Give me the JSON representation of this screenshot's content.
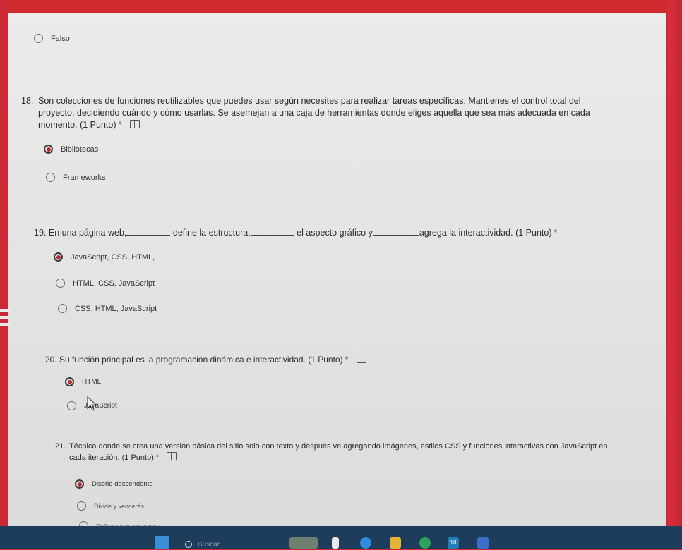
{
  "colors": {
    "accent": "#b72b2e",
    "background": "#c8283a"
  },
  "questions": [
    {
      "number": "",
      "text": "",
      "options": [
        {
          "label": "Falso",
          "selected": false
        }
      ]
    },
    {
      "number": "18.",
      "text": "Son colecciones de funciones reutilizables que puedes usar según necesites para realizar tareas específicas. Mantienes el control total del proyecto, decidiendo cuándo y cómo usarlas. Se asemejan a una caja de herramientas donde eliges aquella que sea más adecuada en cada momento.",
      "points": "(1 Punto)",
      "required": "*",
      "options": [
        {
          "label": "Bibliotecas",
          "selected": true
        },
        {
          "label": "Frameworks",
          "selected": false
        }
      ]
    },
    {
      "number": "19.",
      "parts": [
        "En una página web,",
        "define la estructura,",
        "el aspecto gráfico y",
        "agrega la interactividad."
      ],
      "points": "(1 Punto)",
      "required": "*",
      "options": [
        {
          "label": "JavaScript, CSS, HTML,",
          "selected": true
        },
        {
          "label": "HTML, CSS, JavaScript",
          "selected": false
        },
        {
          "label": "CSS, HTML, JavaScript",
          "selected": false
        }
      ]
    },
    {
      "number": "20.",
      "text": "Su función principal es la programación dinámica e interactividad.",
      "points": "(1 Punto)",
      "required": "*",
      "options": [
        {
          "label": "HTML",
          "selected": true
        },
        {
          "label": "JavaScript",
          "selected": false
        }
      ]
    },
    {
      "number": "21.",
      "text": "Técnica donde se crea una versión básica del sitio solo con texto y después ve agregando imágenes, estilos CSS y funciones interactivas con JavaScript en cada iteración.",
      "points": "(1 Punto)",
      "required": "*",
      "options": [
        {
          "label": "Diseño descendente",
          "selected": true
        },
        {
          "label": "Divide y vencerás",
          "selected": false
        },
        {
          "label": "Refinamiento por pasos",
          "selected": false
        }
      ]
    }
  ],
  "taskbar": {
    "search_placeholder": "Buscar",
    "badge": "18"
  }
}
